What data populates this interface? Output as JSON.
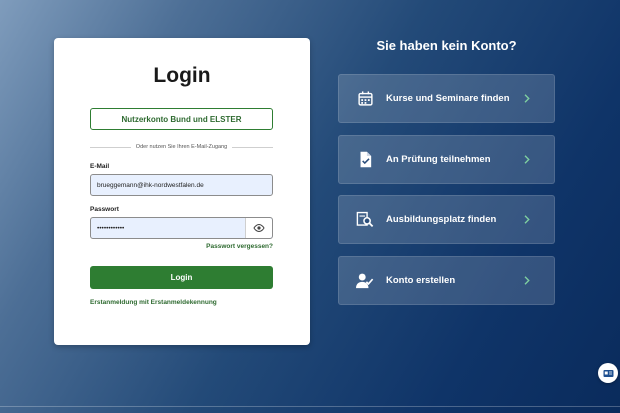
{
  "login": {
    "title": "Login",
    "elster_button": "Nutzerkonto Bund und ELSTER",
    "divider_text": "Oder nutzen Sie Ihren E-Mail-Zugang",
    "email_label": "E-Mail",
    "email_value": "brueggemann@ihk-nordwestfalen.de",
    "password_label": "Passwort",
    "password_value": "••••••••••••",
    "forgot_link": "Passwort vergessen?",
    "submit_label": "Login",
    "first_login_link": "Erstanmeldung mit Erstanmeldekennung"
  },
  "no_account": {
    "heading": "Sie haben kein Konto?",
    "tiles": [
      {
        "label": "Kurse und Seminare finden",
        "icon": "calendar-icon"
      },
      {
        "label": "An Prüfung teilnehmen",
        "icon": "document-check-icon"
      },
      {
        "label": "Ausbildungsplatz finden",
        "icon": "search-document-icon"
      },
      {
        "label": "Konto erstellen",
        "icon": "user-check-icon"
      }
    ]
  },
  "colors": {
    "primary_green": "#2e7d32",
    "chevron_green": "#7fd0a0",
    "background_dark": "#0a2b5c"
  }
}
